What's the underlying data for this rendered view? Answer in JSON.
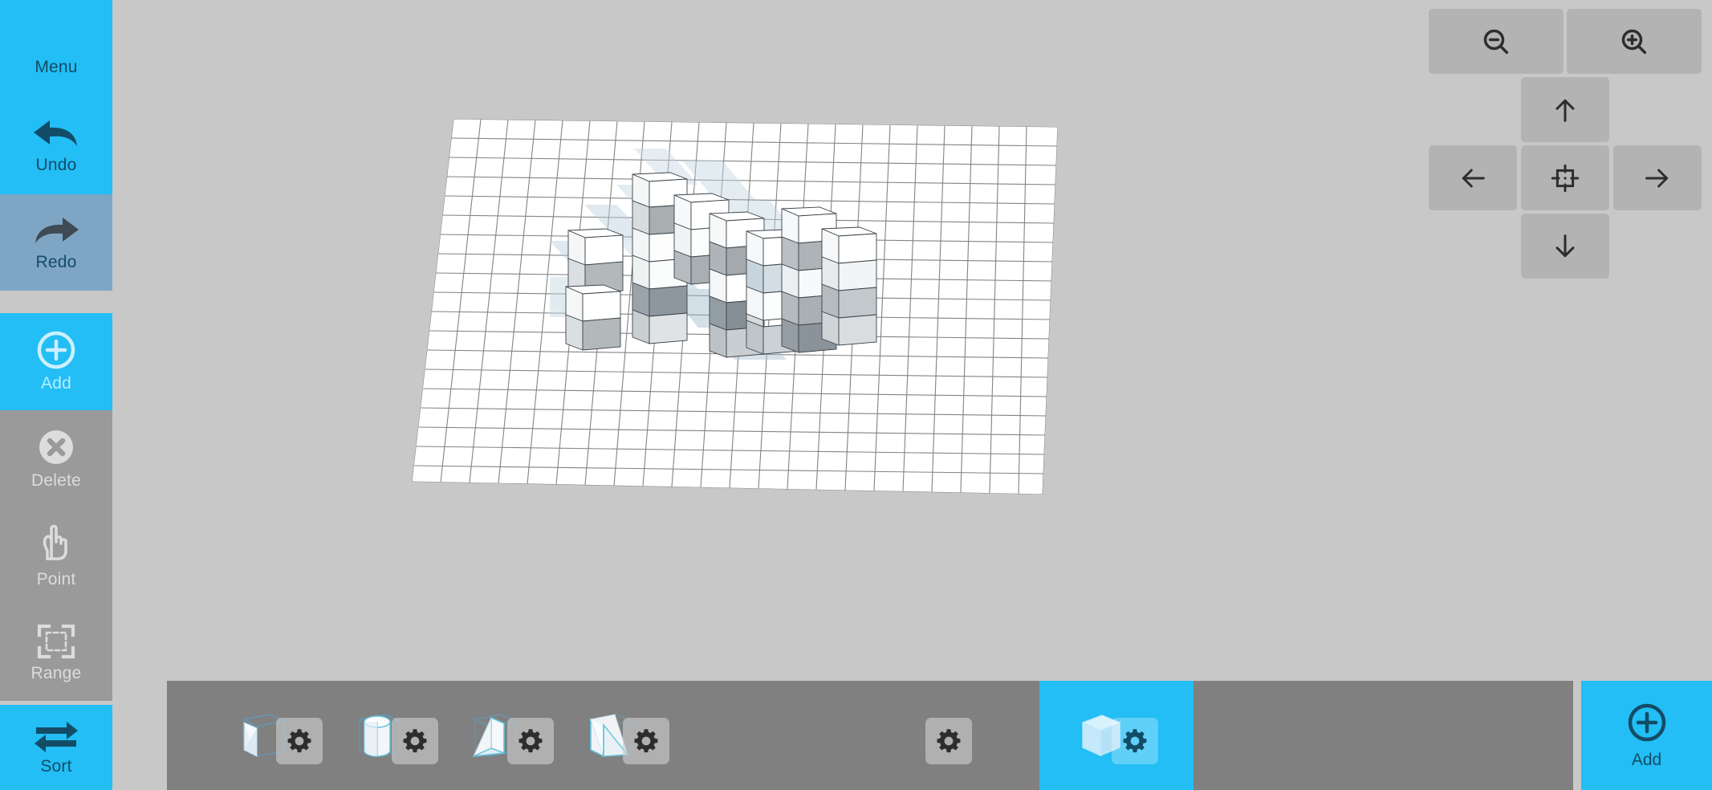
{
  "app": {
    "background_color": "#c8c8c8",
    "accent_color": "#22bef5",
    "accent_dark_text": "#134c66",
    "toolbar_gray": "#808080",
    "sidebar_gray": "#9a9a9a",
    "muted_blue": "#7ea6c4"
  },
  "sidebar": {
    "items": [
      {
        "id": "menu",
        "label": "Menu",
        "icon": "hamburger-icon",
        "state": "active",
        "bg": "#22bef5"
      },
      {
        "id": "undo",
        "label": "Undo",
        "icon": "undo-arrow-icon",
        "state": "active",
        "bg": "#22bef5"
      },
      {
        "id": "redo",
        "label": "Redo",
        "icon": "redo-arrow-icon",
        "state": "disabled",
        "bg": "#7ea6c4"
      },
      {
        "id": "add",
        "label": "Add",
        "icon": "plus-circle-icon",
        "state": "selected",
        "bg": "#22bef5"
      },
      {
        "id": "delete",
        "label": "Delete",
        "icon": "x-circle-icon",
        "state": "inactive",
        "bg": "#9a9a9a"
      },
      {
        "id": "point",
        "label": "Point",
        "icon": "pointing-hand-icon",
        "state": "inactive",
        "bg": "#9a9a9a"
      },
      {
        "id": "range",
        "label": "Range",
        "icon": "marquee-select-icon",
        "state": "inactive",
        "bg": "#9a9a9a"
      },
      {
        "id": "sort",
        "label": "Sort",
        "icon": "swap-arrows-icon",
        "state": "active",
        "bg": "#22bef5"
      }
    ]
  },
  "navpad": {
    "buttons": [
      {
        "id": "zoom-out",
        "icon": "magnifier-minus-icon"
      },
      {
        "id": "zoom-in",
        "icon": "magnifier-plus-icon"
      },
      {
        "id": "pan-up",
        "icon": "arrow-up-icon"
      },
      {
        "id": "pan-left",
        "icon": "arrow-left-icon"
      },
      {
        "id": "recenter",
        "icon": "crosshair-frame-icon"
      },
      {
        "id": "pan-right",
        "icon": "arrow-right-icon"
      },
      {
        "id": "pan-down",
        "icon": "arrow-down-icon"
      }
    ]
  },
  "bottom_toolbar": {
    "tools": [
      {
        "id": "wedge-wireframe",
        "icon": "wedge-shape-icon",
        "gear": "gear-icon",
        "selected": false
      },
      {
        "id": "cylinder",
        "icon": "cylinder-shape-icon",
        "gear": "gear-icon",
        "selected": false
      },
      {
        "id": "prism",
        "icon": "prism-shape-icon",
        "gear": "gear-icon",
        "selected": false
      },
      {
        "id": "ramp",
        "icon": "ramp-shape-icon",
        "gear": "gear-icon",
        "selected": false
      },
      {
        "id": "settings-only",
        "icon": null,
        "gear": "gear-icon",
        "selected": false
      },
      {
        "id": "cube",
        "icon": "cube-shape-icon",
        "gear": "gear-icon",
        "selected": true
      }
    ],
    "add_button": {
      "label": "Add",
      "icon": "plus-circle-icon"
    }
  },
  "scene": {
    "grid": {
      "columns": 22,
      "rows": 19,
      "line_color": "#6e6e6e",
      "plane_color": "#ffffff"
    },
    "blocks_note": "stack of white/gray unit cubes arranged on the grid plane"
  }
}
